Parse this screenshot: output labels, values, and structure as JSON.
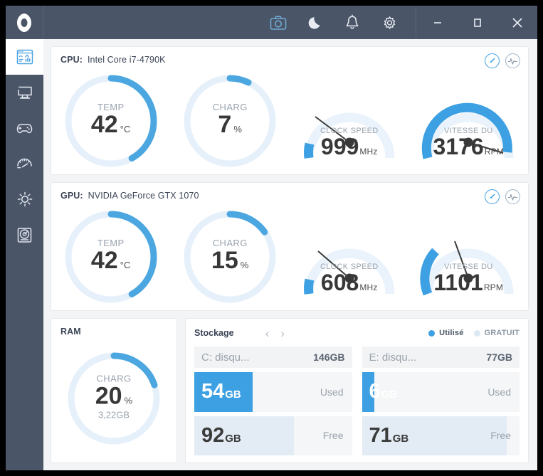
{
  "app": {
    "logo": "hexagon-logo",
    "accent": "#3da0e3",
    "chrome_bg": "#4a5568"
  },
  "titlebar": {
    "icons": [
      {
        "name": "screenshot-icon",
        "label": "Screenshot",
        "active": true
      },
      {
        "name": "moon-icon",
        "label": "Night mode",
        "active": false
      },
      {
        "name": "bell-icon",
        "label": "Notifications",
        "active": false
      },
      {
        "name": "gear-icon",
        "label": "Settings",
        "active": false
      }
    ],
    "window_controls": [
      {
        "name": "minimize-button",
        "label": "Minimize"
      },
      {
        "name": "maximize-button",
        "label": "Maximize"
      },
      {
        "name": "close-button",
        "label": "Close"
      }
    ]
  },
  "sidebar": {
    "items": [
      {
        "name": "sidebar-item-dashboard",
        "icon": "dashboard-icon",
        "label": "Dashboard",
        "active": true
      },
      {
        "name": "sidebar-item-monitor",
        "icon": "monitor-icon",
        "label": "Monitor",
        "active": false
      },
      {
        "name": "sidebar-item-games",
        "icon": "gamepad-icon",
        "label": "Games",
        "active": false
      },
      {
        "name": "sidebar-item-performance",
        "icon": "speedometer-icon",
        "label": "Performance",
        "active": false
      },
      {
        "name": "sidebar-item-lighting",
        "icon": "sun-icon",
        "label": "Lighting",
        "active": false
      },
      {
        "name": "sidebar-item-storage",
        "icon": "disk-icon",
        "label": "Storage",
        "active": false
      }
    ]
  },
  "cpu": {
    "label": "CPU:",
    "model": "Intel Core i7-4790K",
    "tools": [
      {
        "name": "gauge-view-icon",
        "active": true
      },
      {
        "name": "graph-view-icon",
        "active": false
      }
    ],
    "gauges": [
      {
        "type": "ring",
        "label": "TEMP",
        "value": "42",
        "unit": "°C",
        "percent": 42
      },
      {
        "type": "ring",
        "label": "CHARG",
        "value": "7",
        "unit": "%",
        "percent": 7
      },
      {
        "type": "speedo",
        "label": "CLOCK SPEED",
        "value": "999",
        "unit": "MHz",
        "percent": 10,
        "needle": 12
      },
      {
        "type": "speedo",
        "label": "VITESSE DU",
        "value": "3176",
        "unit": "RPM",
        "percent": 92,
        "needle": 82
      }
    ]
  },
  "gpu": {
    "label": "GPU:",
    "model": "NVIDIA GeForce GTX 1070",
    "tools": [
      {
        "name": "gauge-view-icon",
        "active": true
      },
      {
        "name": "graph-view-icon",
        "active": false
      }
    ],
    "gauges": [
      {
        "type": "ring",
        "label": "TEMP",
        "value": "42",
        "unit": "°C",
        "percent": 42
      },
      {
        "type": "ring",
        "label": "CHARG",
        "value": "15",
        "unit": "%",
        "percent": 15
      },
      {
        "type": "speedo",
        "label": "CLOCK SPEED",
        "value": "608",
        "unit": "MHz",
        "percent": 10,
        "needle": 13
      },
      {
        "type": "speedo",
        "label": "VITESSE DU",
        "value": "1101",
        "unit": "RPM",
        "percent": 14,
        "needle": 36
      }
    ]
  },
  "ram": {
    "title": "RAM",
    "label": "CHARG",
    "value": "20",
    "unit": "%",
    "sub": "3,22GB",
    "percent": 20
  },
  "storage": {
    "title": "Stockage",
    "prev_arrow": "‹",
    "next_arrow": "›",
    "legend": [
      {
        "name": "legend-used",
        "label": "Utilisé",
        "color": "#3da0e3"
      },
      {
        "name": "legend-free",
        "label": "GRATUIT",
        "color": "#dce8f2"
      }
    ],
    "used_tag": "Used",
    "free_tag": "Free",
    "disks": [
      {
        "name": "C: disqu...",
        "total": "146GB",
        "used_value": "54",
        "used_unit": "GB",
        "used_percent": 37,
        "free_value": "92",
        "free_unit": "GB",
        "free_percent": 63
      },
      {
        "name": "E: disqu...",
        "total": "77GB",
        "used_value": "6",
        "used_unit": "GB",
        "used_percent": 8,
        "free_value": "71",
        "free_unit": "GB",
        "free_percent": 92
      }
    ]
  }
}
